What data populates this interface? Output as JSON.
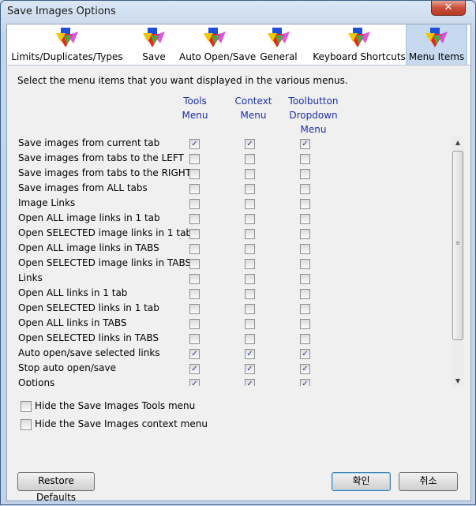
{
  "window": {
    "title": "Save Images Options",
    "close_glyph": "✕"
  },
  "tabs": [
    {
      "label": "Limits/Duplicates/Types",
      "icon": "save-images-icon",
      "active": false
    },
    {
      "label": "Save",
      "icon": "save-images-icon",
      "active": false
    },
    {
      "label": "Auto Open/Save",
      "icon": "save-images-icon",
      "active": false
    },
    {
      "label": "General",
      "icon": "save-images-icon",
      "active": false
    },
    {
      "label": "Keyboard Shortcuts",
      "icon": "save-images-icon",
      "active": false
    },
    {
      "label": "Menu Items",
      "icon": "save-images-icon",
      "active": true
    }
  ],
  "panel": {
    "intro": "Select the menu items that you want displayed in the various menus.",
    "columns": [
      {
        "line1": "Tools",
        "line2": "Menu",
        "line3": ""
      },
      {
        "line1": "Context",
        "line2": "Menu",
        "line3": ""
      },
      {
        "line1": "Toolbutton",
        "line2": "Dropdown",
        "line3": "Menu"
      }
    ],
    "items": [
      {
        "label": "Save images from current tab",
        "tools": true,
        "context": true,
        "toolbutton": true
      },
      {
        "label": "Save images from tabs to the LEFT",
        "tools": false,
        "context": false,
        "toolbutton": false
      },
      {
        "label": "Save images from tabs to the RIGHT",
        "tools": false,
        "context": false,
        "toolbutton": false
      },
      {
        "label": "Save images from ALL tabs",
        "tools": false,
        "context": false,
        "toolbutton": false
      },
      {
        "label": "Image Links",
        "tools": false,
        "context": false,
        "toolbutton": false
      },
      {
        "label": "Open ALL image links in 1 tab",
        "tools": false,
        "context": false,
        "toolbutton": false
      },
      {
        "label": "Open SELECTED image links in 1 tab",
        "tools": false,
        "context": false,
        "toolbutton": false
      },
      {
        "label": "Open ALL image links in TABS",
        "tools": false,
        "context": false,
        "toolbutton": false
      },
      {
        "label": "Open SELECTED image links in TABS",
        "tools": false,
        "context": false,
        "toolbutton": false
      },
      {
        "label": "Links",
        "tools": false,
        "context": false,
        "toolbutton": false
      },
      {
        "label": "Open ALL links in 1 tab",
        "tools": false,
        "context": false,
        "toolbutton": false
      },
      {
        "label": "Open SELECTED links in 1 tab",
        "tools": false,
        "context": false,
        "toolbutton": false
      },
      {
        "label": "Open ALL links in TABS",
        "tools": false,
        "context": false,
        "toolbutton": false
      },
      {
        "label": "Open SELECTED links in TABS",
        "tools": false,
        "context": false,
        "toolbutton": false
      },
      {
        "label": "Auto open/save selected links",
        "tools": true,
        "context": true,
        "toolbutton": true
      },
      {
        "label": "Stop auto open/save",
        "tools": true,
        "context": true,
        "toolbutton": true
      },
      {
        "label": "Options",
        "tools": true,
        "context": true,
        "toolbutton": true
      }
    ],
    "check_glyph": "✓",
    "hide_tools_menu": {
      "label": "Hide the Save Images Tools menu",
      "checked": false
    },
    "hide_context_menu": {
      "label": "Hide the Save Images context menu",
      "checked": false
    }
  },
  "buttons": {
    "restore_defaults": "Restore Defaults",
    "ok": "확인",
    "cancel": "취소"
  },
  "colors": {
    "column_header": "#1c2fb2",
    "check": "#213f8a",
    "active_tab": "#c7d9ef"
  }
}
